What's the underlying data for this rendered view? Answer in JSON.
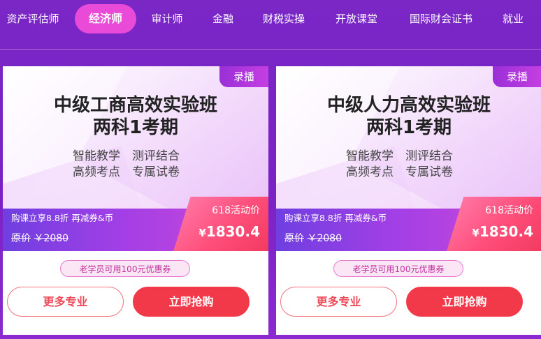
{
  "nav": {
    "items": [
      {
        "label": "资产评估师",
        "active": false
      },
      {
        "label": "经济师",
        "active": true
      },
      {
        "label": "审计师",
        "active": false
      },
      {
        "label": "金融",
        "active": false
      },
      {
        "label": "财税实操",
        "active": false
      },
      {
        "label": "开放课堂",
        "active": false
      },
      {
        "label": "国际财会证书",
        "active": false
      },
      {
        "label": "就业",
        "active": false
      }
    ]
  },
  "cards": [
    {
      "tag": "录播",
      "title_line1": "中级工商高效实验班",
      "title_line2": "两科1考期",
      "features_line1": "智能教学　测评结合",
      "features_line2": "高频考点　专属试卷",
      "promo": "购课立享8.8折 再减券&币",
      "orig_label": "原价",
      "orig_price": "￥2080",
      "price_label": "618活动价",
      "price_symbol": "¥",
      "price": "1830.4",
      "coupon": "老学员可用100元优惠券",
      "more_label": "更多专业",
      "buy_label": "立即抢购"
    },
    {
      "tag": "录播",
      "title_line1": "中级人力高效实验班",
      "title_line2": "两科1考期",
      "features_line1": "智能教学　测评结合",
      "features_line2": "高频考点　专属试卷",
      "promo": "购课立享8.8折 再减券&币",
      "orig_label": "原价",
      "orig_price": "￥2080",
      "price_label": "618活动价",
      "price_symbol": "¥",
      "price": "1830.4",
      "coupon": "老学员可用100元优惠券",
      "more_label": "更多专业",
      "buy_label": "立即抢购"
    }
  ],
  "colors": {
    "background": "#7b22c4",
    "nav_active": "#e94ad8",
    "buy_button": "#f2394a",
    "price_box": "#ff4f7b"
  }
}
